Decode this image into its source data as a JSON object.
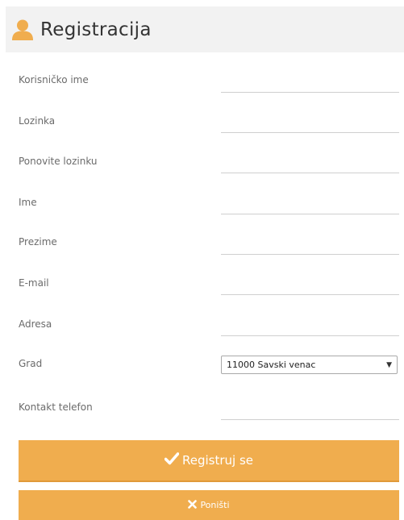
{
  "header": {
    "title": "Registracija",
    "icon": "user-icon"
  },
  "fields": [
    {
      "name": "username",
      "label": "Korisničko ime",
      "value": ""
    },
    {
      "name": "password",
      "label": "Lozinka",
      "value": ""
    },
    {
      "name": "password-repeat",
      "label": "Ponovite lozinku",
      "value": ""
    },
    {
      "name": "first-name",
      "label": "Ime",
      "value": ""
    },
    {
      "name": "last-name",
      "label": "Prezime",
      "value": ""
    },
    {
      "name": "email",
      "label": "E-mail",
      "value": ""
    },
    {
      "name": "address",
      "label": "Adresa",
      "value": ""
    },
    {
      "name": "city",
      "label": "Grad",
      "value": "11000 Savski venac"
    },
    {
      "name": "phone",
      "label": "Kontakt telefon",
      "value": ""
    }
  ],
  "buttons": {
    "register_label": "Registruj se",
    "register_icon": "checkmark-icon",
    "reset_label": "Poništi",
    "reset_icon": "close-icon"
  },
  "colors": {
    "accent": "#f0ad4e",
    "header_bg": "#f2f2f2"
  }
}
